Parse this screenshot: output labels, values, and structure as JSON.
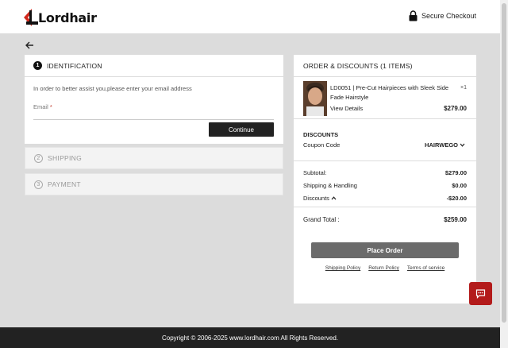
{
  "header": {
    "brand": "Lordhair",
    "secure_label": "Secure Checkout"
  },
  "checkout": {
    "identification": {
      "step_number": "1",
      "title": "IDENTIFICATION",
      "help_text": "In order to better assist you,please enter your email address",
      "email_label": "Email",
      "required_mark": "*",
      "email_value": "",
      "email_placeholder": "",
      "continue_label": "Continue"
    },
    "shipping": {
      "step_number": "2",
      "title": "SHIPPING"
    },
    "payment": {
      "step_number": "3",
      "title": "PAYMENT"
    }
  },
  "order": {
    "title": "ORDER & DISCOUNTS (1 ITEMS)",
    "item": {
      "title": "LD0051 | Pre-Cut Hairpieces with Sleek Side Fade Hairstyle",
      "qty": "×1",
      "view_details": "View Details",
      "price": "$279.00"
    },
    "discounts_title": "DISCOUNTS",
    "coupon_label": "Coupon Code",
    "coupon_code": "HAIRWEGO",
    "subtotal_label": "Subtotal:",
    "subtotal_value": "$279.00",
    "shipping_label": "Shipping & Handling",
    "shipping_value": "$0.00",
    "discounts_label": "Discounts",
    "discounts_value": "-$20.00",
    "grand_label": "Grand Total :",
    "grand_value": "$259.00",
    "place_order_label": "Place Order",
    "links": [
      "Shipping Policy",
      "Return Policy",
      "Terms of service"
    ]
  },
  "footer": {
    "copyright": "Copyright © 2006-2025 www.lordhair.com All Rights Reserved."
  },
  "colors": {
    "brand_red": "#d0281c",
    "chat_red": "#b31b1b",
    "dark_button": "#222222",
    "place_order_gray": "#6b6b6b"
  },
  "icons": {
    "logo": "lordhair-logo-icon",
    "lock": "lock-icon",
    "back": "arrow-left-icon",
    "coupon_toggle": "chevron-down-icon",
    "discounts_toggle": "chevron-up-icon",
    "chat": "chat-icon"
  }
}
